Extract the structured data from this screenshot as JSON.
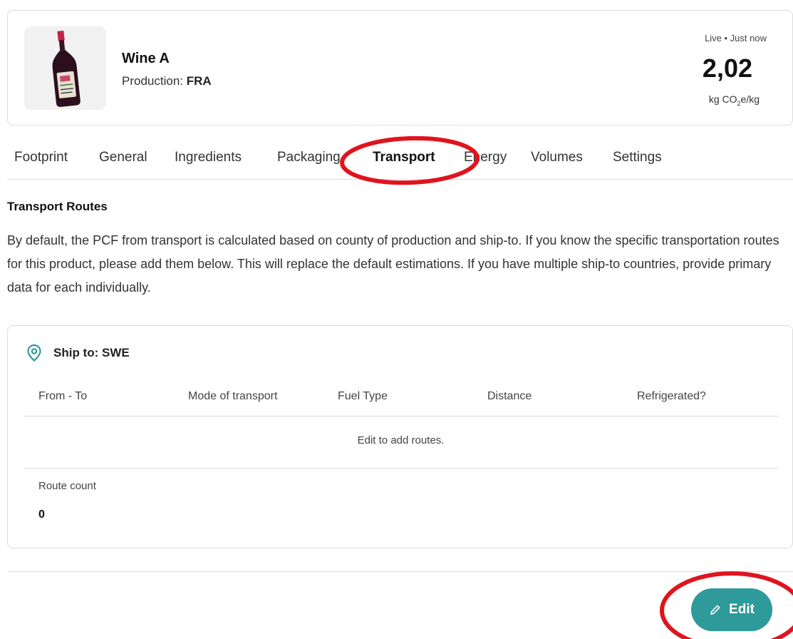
{
  "product": {
    "name": "Wine A",
    "production_label": "Production:",
    "production_country": "FRA",
    "image_icon": "wine-bottle-icon"
  },
  "footprint": {
    "status": "Live • Just now",
    "value": "2,02",
    "unit_prefix": "kg CO",
    "unit_sub": "2",
    "unit_suffix": "e/kg"
  },
  "tabs": [
    {
      "label": "Footprint",
      "active": false
    },
    {
      "label": "General",
      "active": false
    },
    {
      "label": "Ingredients",
      "active": false
    },
    {
      "label": "Packaging",
      "active": false
    },
    {
      "label": "Transport",
      "active": true
    },
    {
      "label": "Energy",
      "active": false
    },
    {
      "label": "Volumes",
      "active": false
    },
    {
      "label": "Settings",
      "active": false
    }
  ],
  "section": {
    "title": "Transport Routes",
    "description": "By default, the PCF from transport is calculated based on county of production and ship-to. If you know the specific transportation routes for this product, please add them below. This will replace the default estimations. If you have multiple ship-to countries, provide primary data for each individually."
  },
  "ship_to": {
    "title": "Ship to: SWE",
    "icon": "location-pin-icon",
    "columns": [
      "From - To",
      "Mode of transport",
      "Fuel Type",
      "Distance",
      "Refrigerated?"
    ],
    "empty_message": "Edit to add routes.",
    "route_count_label": "Route count",
    "route_count_value": "0"
  },
  "actions": {
    "edit_label": "Edit",
    "edit_icon": "pencil-icon"
  },
  "colors": {
    "accent": "#2e9a9a",
    "annotation": "#e0141e"
  }
}
